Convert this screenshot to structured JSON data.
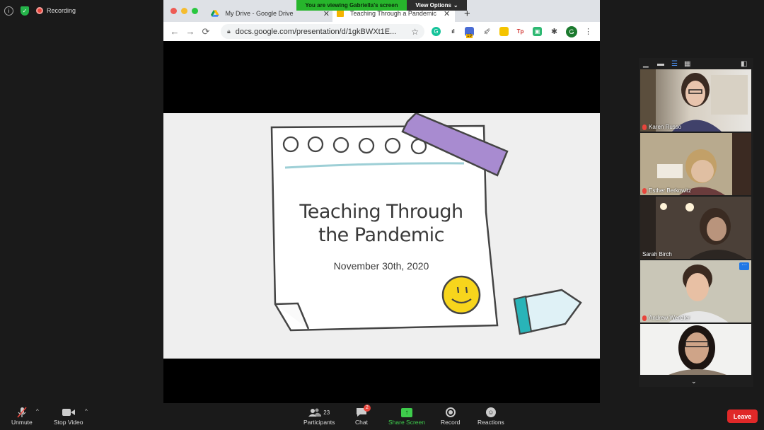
{
  "meeting": {
    "recording_label": "Recording",
    "info_icon": "info-icon",
    "security_icon": "shield-icon"
  },
  "banner": {
    "viewing_text": "You are viewing Gabriella's screen",
    "view_options_label": "View Options",
    "accent": "#27b52c"
  },
  "browser": {
    "tabs": [
      {
        "title": "My Drive - Google Drive",
        "icon": "google-drive-icon"
      },
      {
        "title": "Teaching Through a Pandemic",
        "icon": "google-slides-icon"
      }
    ],
    "new_tab_label": "+",
    "url": "docs.google.com/presentation/d/1gkBWXt1E...",
    "profile_initial": "G",
    "ext_badge": "19"
  },
  "slide": {
    "title_line1": "Teaching Through",
    "title_line2": "the Pandemic",
    "date": "November 30th, 2020"
  },
  "gallery": {
    "participants": [
      {
        "name": "Karen Russo",
        "muted": true
      },
      {
        "name": "Esther Berkowitz",
        "muted": true
      },
      {
        "name": "Sarah Birch",
        "muted": false
      },
      {
        "name": "Andrew Wenzler",
        "muted": true
      },
      {
        "name": "",
        "muted": false
      }
    ],
    "more_label": "···"
  },
  "toolbar": {
    "unmute_label": "Unmute",
    "stop_video_label": "Stop Video",
    "participants_label": "Participants",
    "participants_count": "23",
    "chat_label": "Chat",
    "chat_badge": "2",
    "share_label": "Share Screen",
    "record_label": "Record",
    "reactions_label": "Reactions",
    "leave_label": "Leave",
    "share_color": "#3ecb4c",
    "leave_color": "#e02828"
  }
}
